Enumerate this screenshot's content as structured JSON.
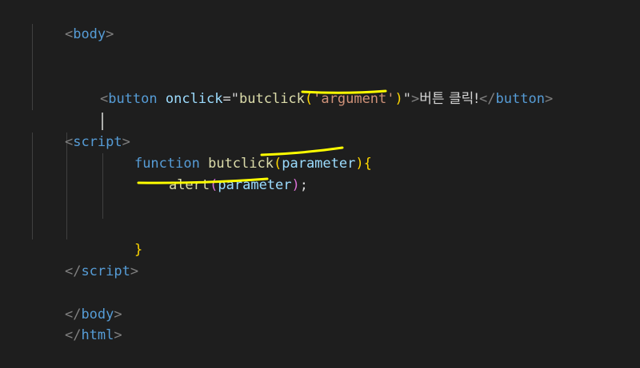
{
  "editor": {
    "lines": {
      "l1": {
        "open": "<",
        "tag": "body",
        "close": ">"
      },
      "l2": {
        "open": "<",
        "tag": "button",
        "attr": "onclick",
        "eq": "=\"",
        "fn": "butclick",
        "lp": "(",
        "arg": "'argument'",
        "rp": ")",
        "q": "\"",
        "gt": ">",
        "label": "버튼 클릭!",
        "closeOpen": "</",
        "closeTag": "button",
        "closeGt": ">"
      },
      "l3": {
        "open": "<",
        "tag": "script",
        "close": ">"
      },
      "l4": {
        "kw": "function",
        "fn": "butclick",
        "lp": "(",
        "param": "parameter",
        "rp": ")",
        "brace": "{"
      },
      "l5": {
        "fn": "alert",
        "lp": "(",
        "param": "parameter",
        "rp": ")",
        "semi": ";"
      },
      "l6": {
        "brace": "}"
      },
      "l7": {
        "open": "</",
        "tag": "script",
        "close": ">"
      },
      "l8": {
        "open": "</",
        "tag": "body",
        "close": ">"
      },
      "l9": {
        "open": "</",
        "tag": "html",
        "close": ">"
      }
    },
    "colors": {
      "background": "#1e1e1e",
      "annotation": "#ffff00"
    }
  }
}
